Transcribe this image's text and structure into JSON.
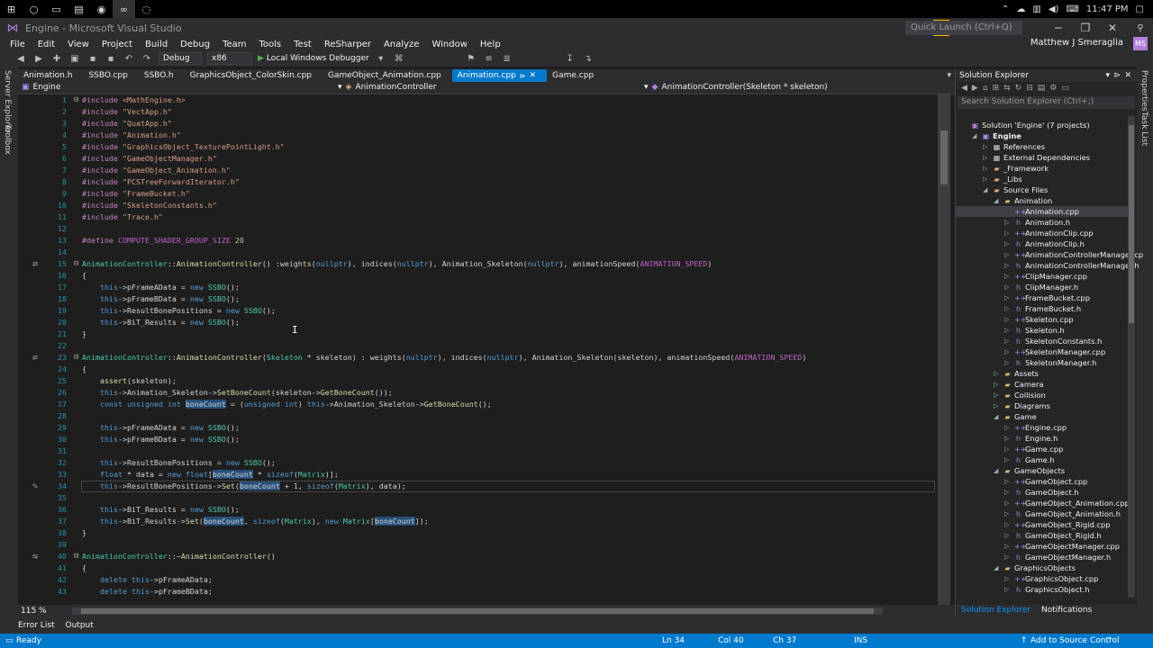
{
  "window": {
    "title": "Engine - Microsoft Visual Studio",
    "quick_launch_placeholder": "Quick Launch (Ctrl+Q)",
    "user_name": "Matthew J Smeraglia",
    "user_initials": "MS"
  },
  "taskbar": {
    "clock": "11:47 PM"
  },
  "menu": [
    "File",
    "Edit",
    "View",
    "Project",
    "Build",
    "Debug",
    "Team",
    "Tools",
    "Test",
    "ReSharper",
    "Analyze",
    "Window",
    "Help"
  ],
  "toolbar": {
    "config": "Debug",
    "platform": "x86",
    "debugger_label": "Local Windows Debugger"
  },
  "side_tabs": {
    "left": [
      "Server Explorer",
      "Toolbox"
    ],
    "right": [
      "Properties",
      "Task List"
    ]
  },
  "doc_tabs": [
    {
      "label": "Animation.h",
      "active": false
    },
    {
      "label": "SSBO.cpp",
      "active": false
    },
    {
      "label": "SSBO.h",
      "active": false
    },
    {
      "label": "GraphicsObject_ColorSkin.cpp",
      "active": false
    },
    {
      "label": "GameObject_Animation.cpp",
      "active": false
    },
    {
      "label": "Animation.cpp",
      "active": true
    },
    {
      "label": "Game.cpp",
      "active": false
    }
  ],
  "nav": {
    "project": "Engine",
    "scope": "AnimationController",
    "member": "AnimationController(Skeleton * skeleton)"
  },
  "code_lines": [
    {
      "n": "1",
      "fold": "⊟",
      "html": "<span class='inc'>#include</span> <span class='str'>&lt;MathEngine.h&gt;</span>"
    },
    {
      "n": "2",
      "html": "<span class='inc'>#include</span> <span class='str'>\"VectApp.h\"</span>"
    },
    {
      "n": "3",
      "html": "<span class='inc'>#include</span> <span class='str'>\"QuatApp.h\"</span>"
    },
    {
      "n": "4",
      "html": "<span class='inc'>#include</span> <span class='str'>\"Animation.h\"</span>"
    },
    {
      "n": "5",
      "html": "<span class='inc'>#include</span> <span class='str'>\"GraphicsObject_TexturePointLight.h\"</span>"
    },
    {
      "n": "6",
      "html": "<span class='inc'>#include</span> <span class='str'>\"GameObjectManager.h\"</span>"
    },
    {
      "n": "7",
      "html": "<span class='inc'>#include</span> <span class='str'>\"GameObject_Animation.h\"</span>"
    },
    {
      "n": "8",
      "html": "<span class='inc'>#include</span> <span class='str'>\"PCSTreeForwardIterator.h\"</span>"
    },
    {
      "n": "9",
      "html": "<span class='inc'>#include</span> <span class='str'>\"FrameBucket.h\"</span>"
    },
    {
      "n": "10",
      "html": "<span class='inc'>#include</span> <span class='str'>\"SkeletonConstants.h\"</span>"
    },
    {
      "n": "11",
      "html": "<span class='inc'>#include</span> <span class='str'>\"Trace.h\"</span>"
    },
    {
      "n": "12",
      "html": ""
    },
    {
      "n": "13",
      "html": "<span class='inc'>#define</span> <span class='mac'>COMPUTE_SHADER_GROUP_SIZE</span> <span class='num'>20</span>"
    },
    {
      "n": "14",
      "html": ""
    },
    {
      "n": "15",
      "fold": "⊟",
      "glyph": "⇄",
      "html": "<span class='type'>AnimationController</span>::<span class='fn'>AnimationController</span>() :weights(<span class='kw'>nullptr</span>), indices(<span class='kw'>nullptr</span>), Animation_Skeleton(<span class='kw'>nullptr</span>), animationSpeed(<span class='mac'>ANIMATION_SPEED</span>)"
    },
    {
      "n": "16",
      "html": "{"
    },
    {
      "n": "17",
      "html": "    <span class='kw'>this</span>-&gt;pFrameAData = <span class='kw'>new</span> <span class='type'>SSBO</span>();"
    },
    {
      "n": "18",
      "html": "    <span class='kw'>this</span>-&gt;pFrameBData = <span class='kw'>new</span> <span class='type'>SSBO</span>();"
    },
    {
      "n": "19",
      "html": "    <span class='kw'>this</span>-&gt;ResultBonePositions = <span class='kw'>new</span> <span class='type'>SSBO</span>();"
    },
    {
      "n": "20",
      "html": "    <span class='kw'>this</span>-&gt;BiT_Results = <span class='kw'>new</span> <span class='type'>SSBO</span>();"
    },
    {
      "n": "21",
      "html": "}"
    },
    {
      "n": "22",
      "html": ""
    },
    {
      "n": "23",
      "fold": "⊟",
      "glyph": "⇄",
      "html": "<span class='type'>AnimationController</span>::<span class='fn'>AnimationController</span>(<span class='type'>Skeleton</span> * skeleton) : weights(<span class='kw'>nullptr</span>), indices(<span class='kw'>nullptr</span>), Animation_Skeleton(skeleton), animationSpeed(<span class='mac'>ANIMATION_SPEED</span>)"
    },
    {
      "n": "24",
      "html": "{"
    },
    {
      "n": "25",
      "html": "    <span class='fn'>assert</span>(skeleton);"
    },
    {
      "n": "26",
      "html": "    <span class='kw'>this</span>-&gt;Animation_Skeleton-&gt;<span class='fn'>SetBoneCount</span>(skeleton-&gt;<span class='fn'>GetBoneCount</span>());"
    },
    {
      "n": "27",
      "html": "    <span class='kw'>const</span> <span class='kw'>unsigned</span> <span class='kw'>int</span> <span class='hl'>boneCount</span> = (<span class='kw'>unsigned</span> <span class='kw'>int</span>) <span class='kw'>this</span>-&gt;Animation_Skeleton-&gt;<span class='fn'>GetBoneCount</span>();"
    },
    {
      "n": "28",
      "html": ""
    },
    {
      "n": "29",
      "html": "    <span class='kw'>this</span>-&gt;pFrameAData = <span class='kw'>new</span> <span class='type'>SSBO</span>();"
    },
    {
      "n": "30",
      "html": "    <span class='kw'>this</span>-&gt;pFrameBData = <span class='kw'>new</span> <span class='type'>SSBO</span>();"
    },
    {
      "n": "31",
      "html": ""
    },
    {
      "n": "32",
      "html": "    <span class='kw'>this</span>-&gt;ResultBonePositions = <span class='kw'>new</span> <span class='type'>SSBO</span>();"
    },
    {
      "n": "33",
      "html": "    <span class='kw'>float</span> * data = <span class='kw'>new</span> <span class='kw'>float</span>[<span class='hl'>boneCount</span> * <span class='kw'>sizeof</span>(<span class='type'>Matrix</span>)];"
    },
    {
      "n": "34",
      "current": true,
      "glyph": "✎",
      "html": "    <span class='kw'>this</span>-&gt;ResultBonePositions-&gt;<span class='fn'>Set</span>(<span class='hl'>boneCount</span> + <span class='num'>1</span>, <span class='kw'>sizeof</span>(<span class='type'>Matrix</span>), data);"
    },
    {
      "n": "35",
      "html": ""
    },
    {
      "n": "36",
      "html": "    <span class='kw'>this</span>-&gt;BiT_Results = <span class='kw'>new</span> <span class='type'>SSBO</span>();"
    },
    {
      "n": "37",
      "html": "    <span class='kw'>this</span>-&gt;BiT_Results-&gt;<span class='fn'>Set</span>(<span class='hl'>boneCount</span>, <span class='kw'>sizeof</span>(<span class='type'>Matrix</span>), <span class='kw'>new</span> <span class='type'>Matrix</span>[<span class='hl'>boneCount</span>]);"
    },
    {
      "n": "38",
      "html": "}"
    },
    {
      "n": "39",
      "html": ""
    },
    {
      "n": "40",
      "fold": "⊟",
      "glyph": "⇆",
      "html": "<span class='type'>AnimationController</span>::~<span class='fn'>AnimationController</span>()"
    },
    {
      "n": "41",
      "html": "{"
    },
    {
      "n": "42",
      "html": "    <span class='kw'>delete</span> <span class='kw'>this</span>-&gt;pFrameAData;"
    },
    {
      "n": "43",
      "html": "    <span class='kw'>delete</span> <span class='kw'>this</span>-&gt;pFrameBData;"
    }
  ],
  "editor_status": {
    "zoom": "115 %"
  },
  "solution_explorer": {
    "title": "Solution Explorer",
    "search_placeholder": "Search Solution Explorer (Ctrl+;)",
    "items": [
      {
        "label": "Solution 'Engine' (7 projects)",
        "depth": 0,
        "icon": "sol",
        "arrow": ""
      },
      {
        "label": "Engine",
        "depth": 1,
        "icon": "proj",
        "arrow": "◢",
        "bold": true
      },
      {
        "label": "References",
        "depth": 2,
        "icon": "ref",
        "arrow": "▷"
      },
      {
        "label": "External Dependencies",
        "depth": 2,
        "icon": "ref",
        "arrow": "▷"
      },
      {
        "label": "_Framework",
        "depth": 2,
        "icon": "folder",
        "arrow": "▷"
      },
      {
        "label": "_Libs",
        "depth": 2,
        "icon": "folder",
        "arrow": "▷"
      },
      {
        "label": "Source Files",
        "depth": 2,
        "icon": "folder",
        "arrow": "◢"
      },
      {
        "label": "Animation",
        "depth": 3,
        "icon": "folder",
        "arrow": "◢"
      },
      {
        "label": "Animation.cpp",
        "depth": 4,
        "icon": "cpp",
        "arrow": "",
        "selected": true
      },
      {
        "label": "Animation.h",
        "depth": 4,
        "icon": "h",
        "arrow": "▷"
      },
      {
        "label": "AnimationClip.cpp",
        "depth": 4,
        "icon": "cpp",
        "arrow": "▷"
      },
      {
        "label": "AnimationClip.h",
        "depth": 4,
        "icon": "h",
        "arrow": "▷"
      },
      {
        "label": "AnimationControllerManager.cp",
        "depth": 4,
        "icon": "cpp",
        "arrow": "▷"
      },
      {
        "label": "AnimationControllerManager.h",
        "depth": 4,
        "icon": "h",
        "arrow": "▷"
      },
      {
        "label": "ClipManager.cpp",
        "depth": 4,
        "icon": "cpp",
        "arrow": "▷"
      },
      {
        "label": "ClipManager.h",
        "depth": 4,
        "icon": "h",
        "arrow": "▷"
      },
      {
        "label": "FrameBucket.cpp",
        "depth": 4,
        "icon": "cpp",
        "arrow": "▷"
      },
      {
        "label": "FrameBucket.h",
        "depth": 4,
        "icon": "h",
        "arrow": "▷"
      },
      {
        "label": "Skeleton.cpp",
        "depth": 4,
        "icon": "cpp",
        "arrow": "▷"
      },
      {
        "label": "Skeleton.h",
        "depth": 4,
        "icon": "h",
        "arrow": "▷"
      },
      {
        "label": "SkeletonConstants.h",
        "depth": 4,
        "icon": "h",
        "arrow": "▷"
      },
      {
        "label": "SkeletonManager.cpp",
        "depth": 4,
        "icon": "cpp",
        "arrow": "▷"
      },
      {
        "label": "SkeletonManager.h",
        "depth": 4,
        "icon": "h",
        "arrow": "▷"
      },
      {
        "label": "Assets",
        "depth": 3,
        "icon": "folder",
        "arrow": "▷"
      },
      {
        "label": "Camera",
        "depth": 3,
        "icon": "folder",
        "arrow": "▷"
      },
      {
        "label": "Collision",
        "depth": 3,
        "icon": "folder",
        "arrow": "▷"
      },
      {
        "label": "Diagrams",
        "depth": 3,
        "icon": "folder",
        "arrow": "▷"
      },
      {
        "label": "Game",
        "depth": 3,
        "icon": "folder",
        "arrow": "◢"
      },
      {
        "label": "Engine.cpp",
        "depth": 4,
        "icon": "cpp",
        "arrow": "▷"
      },
      {
        "label": "Engine.h",
        "depth": 4,
        "icon": "h",
        "arrow": "▷"
      },
      {
        "label": "Game.cpp",
        "depth": 4,
        "icon": "cpp",
        "arrow": "▷"
      },
      {
        "label": "Game.h",
        "depth": 4,
        "icon": "h",
        "arrow": "▷"
      },
      {
        "label": "GameObjects",
        "depth": 3,
        "icon": "folder",
        "arrow": "◢"
      },
      {
        "label": "GameObject.cpp",
        "depth": 4,
        "icon": "cpp",
        "arrow": "▷"
      },
      {
        "label": "GameObject.h",
        "depth": 4,
        "icon": "h",
        "arrow": "▷"
      },
      {
        "label": "GameObject_Animation.cpp",
        "depth": 4,
        "icon": "cpp",
        "arrow": "▷"
      },
      {
        "label": "GameObject_Animation.h",
        "depth": 4,
        "icon": "h",
        "arrow": "▷"
      },
      {
        "label": "GameObject_Rigid.cpp",
        "depth": 4,
        "icon": "cpp",
        "arrow": "▷"
      },
      {
        "label": "GameObject_Rigid.h",
        "depth": 4,
        "icon": "h",
        "arrow": "▷"
      },
      {
        "label": "GameObjectManager.cpp",
        "depth": 4,
        "icon": "cpp",
        "arrow": "▷"
      },
      {
        "label": "GameObjectManager.h",
        "depth": 4,
        "icon": "h",
        "arrow": "▷"
      },
      {
        "label": "GraphicsObjects",
        "depth": 3,
        "icon": "folder",
        "arrow": "◢"
      },
      {
        "label": "GraphicsObject.cpp",
        "depth": 4,
        "icon": "cpp",
        "arrow": "▷"
      },
      {
        "label": "GraphicsObject.h",
        "depth": 4,
        "icon": "h",
        "arrow": "▷"
      }
    ],
    "bottom_tabs": [
      "Solution Explorer",
      "Notifications"
    ]
  },
  "tool_tabs": [
    "Error List",
    "Output"
  ],
  "statusbar": {
    "state": "Ready",
    "ln": "Ln 34",
    "col": "Col 40",
    "ch": "Ch 37",
    "mode": "INS",
    "source_control": "Add to Source Control"
  },
  "colors": {
    "accent": "#007acc",
    "background": "#1e1e1e",
    "chrome": "#2d2d30"
  }
}
